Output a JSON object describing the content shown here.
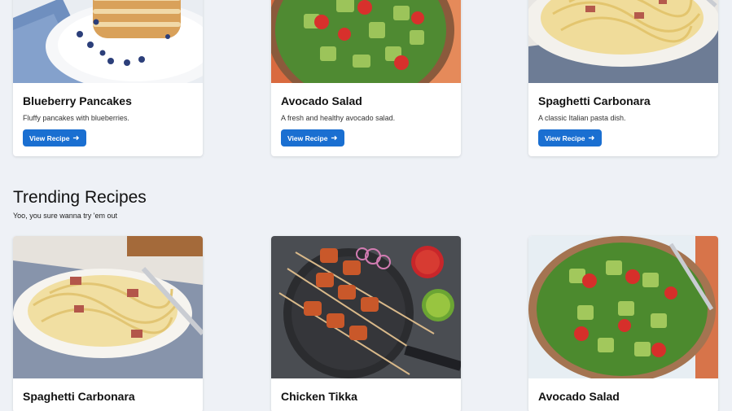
{
  "featured": [
    {
      "title": "Blueberry Pancakes",
      "desc": "Fluffy pancakes with blueberries.",
      "button": "View Recipe",
      "image": "pancakes-photo"
    },
    {
      "title": "Avocado Salad",
      "desc": "A fresh and healthy avocado salad.",
      "button": "View Recipe",
      "image": "avocado-salad-photo"
    },
    {
      "title": "Spaghetti Carbonara",
      "desc": "A classic Italian pasta dish.",
      "button": "View Recipe",
      "image": "carbonara-photo"
    }
  ],
  "trending": {
    "title": "Trending Recipes",
    "subtitle": "Yoo, you sure wanna try 'em out",
    "cards": [
      {
        "title": "Spaghetti Carbonara",
        "image": "carbonara-photo"
      },
      {
        "title": "Chicken Tikka",
        "image": "chicken-tikka-photo"
      },
      {
        "title": "Avocado Salad",
        "image": "avocado-salad-photo"
      }
    ]
  },
  "colors": {
    "accent": "#1a6fd1",
    "background": "#eef1f6"
  }
}
